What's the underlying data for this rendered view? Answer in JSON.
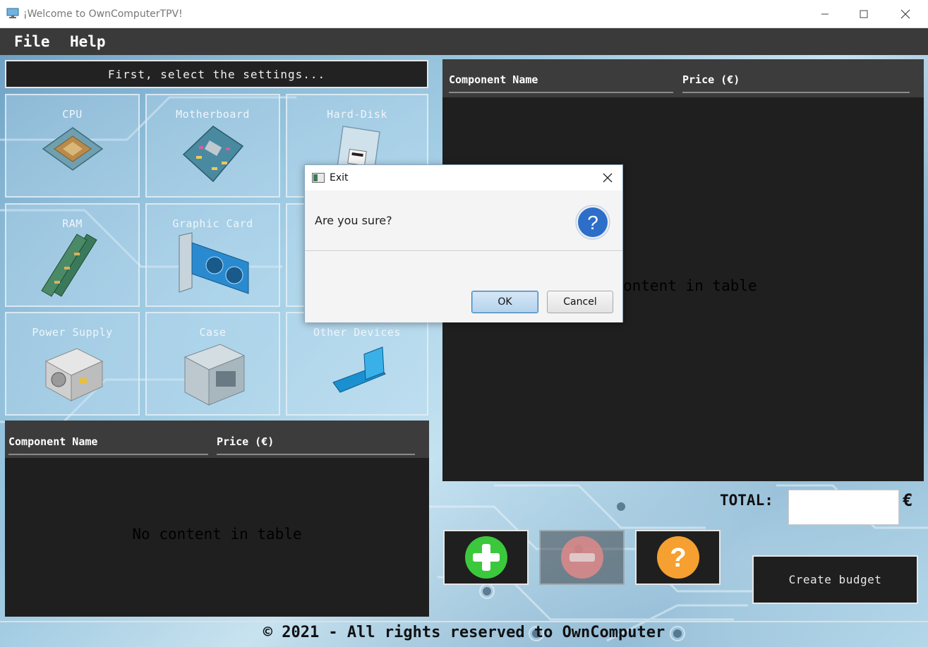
{
  "window": {
    "title": "¡Welcome to OwnComputerTPV!"
  },
  "menu": {
    "items": [
      "File",
      "Help"
    ]
  },
  "settings": {
    "header": "First, select the settings...",
    "tiles": [
      "CPU",
      "Motherboard",
      "Hard-Disk",
      "RAM",
      "Graphic Card",
      "",
      "Power Supply",
      "Case",
      "Other Devices"
    ]
  },
  "selected_table": {
    "columns": [
      "Component Name",
      "Price (€)"
    ],
    "empty_text": "No content in table"
  },
  "available_table": {
    "columns": [
      "Component Name",
      "Price (€)"
    ],
    "empty_text_visible": "ontent in table"
  },
  "total": {
    "label": "TOTAL:",
    "value": "",
    "currency": "€"
  },
  "actions": {
    "add": "plus-icon",
    "remove": "minus-icon",
    "help": "question-icon",
    "create_budget": "Create budget"
  },
  "footer": {
    "text": "© 2021 - All rights reserved to OwnComputer"
  },
  "dialog": {
    "title": "Exit",
    "message": "Are you sure?",
    "ok": "OK",
    "cancel": "Cancel"
  },
  "colors": {
    "add_green": "#3cc83c",
    "remove_red": "#e08a8a",
    "help_orange": "#f5a030",
    "question_blue": "#2d6ec8"
  }
}
